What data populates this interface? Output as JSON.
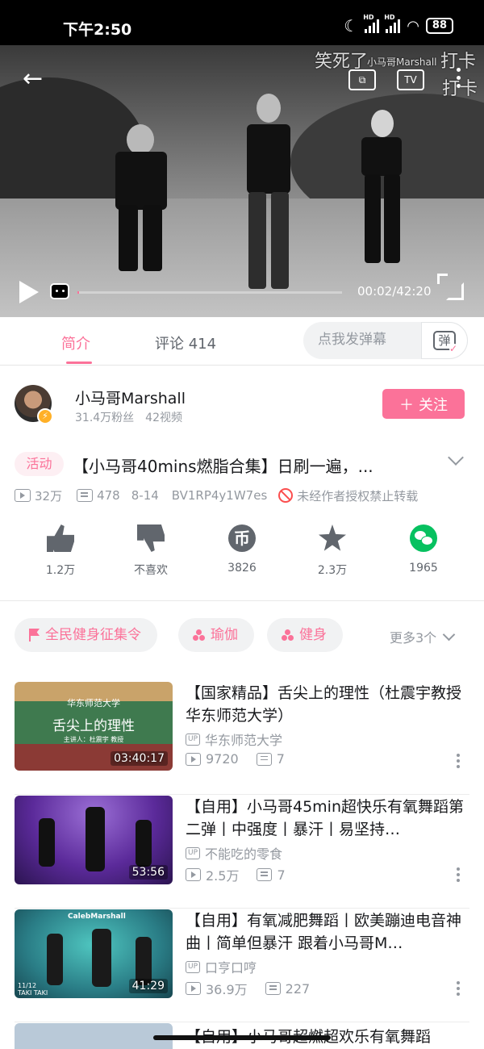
{
  "status_bar": {
    "time": "下午2:50",
    "battery": "88"
  },
  "player": {
    "current_time": "00:02",
    "total_time": "42:20",
    "time_display": "00:02/42:20",
    "progress": 0.0008,
    "danmaku": [
      "笑死了",
      "小马哥Marshall",
      "打卡",
      "打卡"
    ],
    "top_icons": [
      "cast-icon",
      "tv-icon",
      "more-icon"
    ]
  },
  "tabs": {
    "intro": "简介",
    "comments": "评论 414",
    "danmaku_placeholder": "点我发弹幕",
    "danmaku_toggle": "弹"
  },
  "uploader": {
    "name": "小马哥Marshall",
    "stats": "31.4万粉丝　42视频",
    "follow_label": "关注",
    "follow_plus": "＋"
  },
  "video": {
    "activity_tag": "活动",
    "title": "【小马哥40mins燃脂合集】日刷一遍，...",
    "views": "32万",
    "danmaku_count": "478",
    "date": "8-14",
    "bvid": "BV1RP4y1W7es",
    "copyright": "未经作者授权禁止转载"
  },
  "actions": [
    {
      "icon": "like-icon",
      "label": "1.2万"
    },
    {
      "icon": "dislike-icon",
      "label": "不喜欢"
    },
    {
      "icon": "coin-icon",
      "label": "3826",
      "glyph": "币"
    },
    {
      "icon": "favorite-icon",
      "label": "2.3万"
    },
    {
      "icon": "wechat-share-icon",
      "label": "1965"
    }
  ],
  "tags": {
    "items": [
      "全民健身征集令",
      "瑜伽",
      "健身"
    ],
    "more_label": "更多3个"
  },
  "related": [
    {
      "title": "【国家精品】舌尖上的理性（杜震宇教授 华东师范大学）",
      "author": "华东师范大学",
      "views": "9720",
      "danmaku": "7",
      "duration": "03:40:17",
      "thumb_text": "舌尖上的理性",
      "thumb_school": "华东师范大学",
      "thumb_sub": "主讲人：杜震宇 教授"
    },
    {
      "title": "【自用】小马哥45min超快乐有氧舞蹈第二弹丨中强度丨暴汗丨易坚持…",
      "author": "不能吃的零食",
      "views": "2.5万",
      "danmaku": "7",
      "duration": "53:56"
    },
    {
      "title": "【自用】有氧减肥舞蹈丨欧美蹦迪电音神曲丨简单但暴汗 跟着小马哥M…",
      "author": "口亨口哼",
      "views": "36.9万",
      "danmaku": "227",
      "duration": "41:29",
      "thumb_brand": "CalebMarshall",
      "thumb_corner": "11/12 TAKI TAKI"
    }
  ],
  "partial_next_title": "【自用】小马哥超燃超欢乐有氧舞蹈",
  "colors": {
    "accent": "#fb7299",
    "text": "#18191c",
    "secondary": "#9499a0",
    "wechat": "#07c160"
  }
}
